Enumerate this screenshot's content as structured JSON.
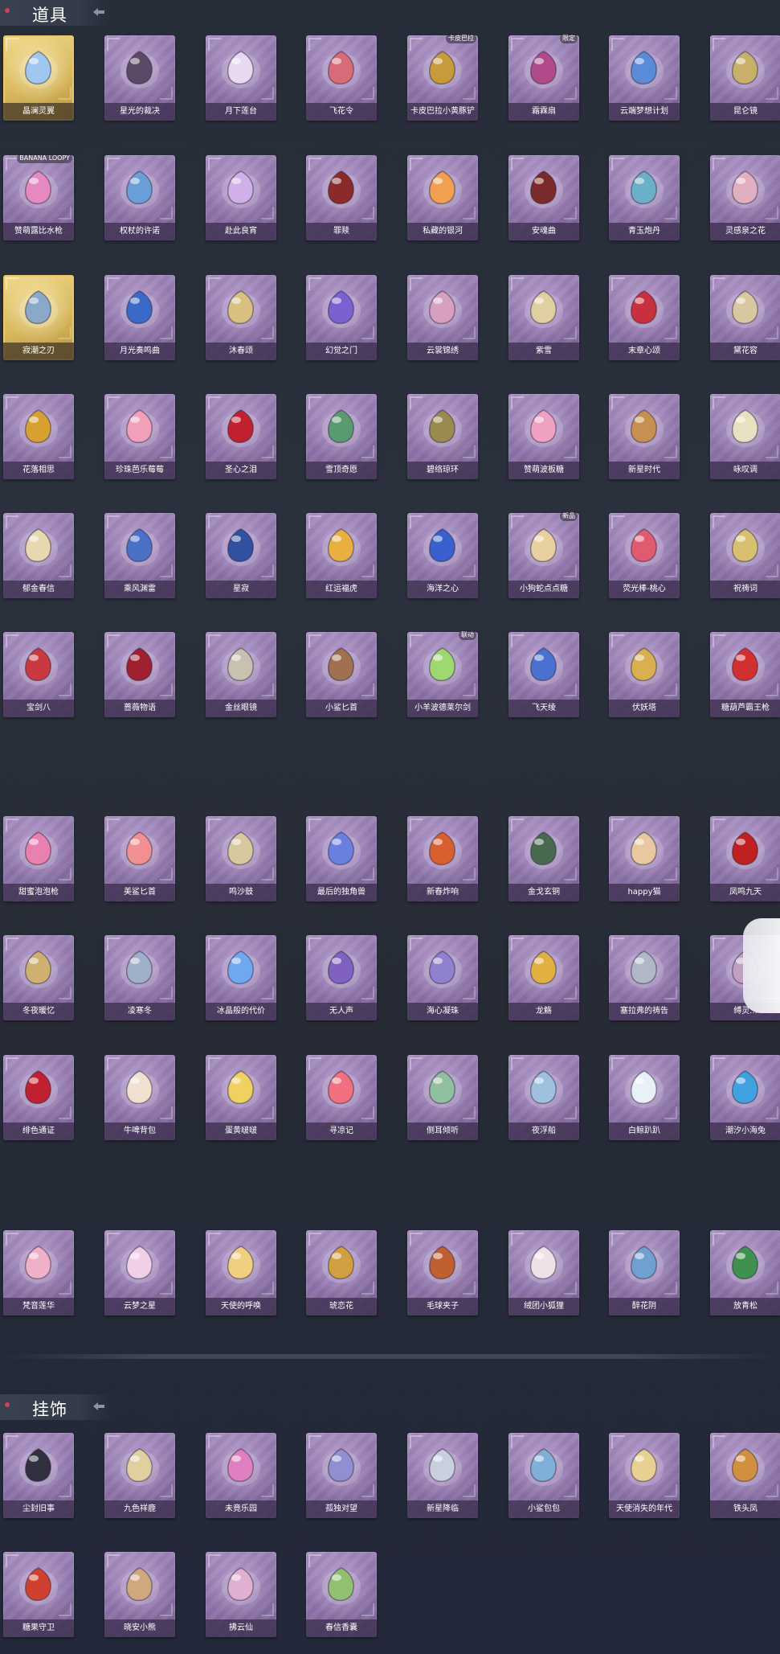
{
  "sections": {
    "props_title": "道具",
    "pendants_title": "挂饰"
  },
  "props_rows": [
    {
      "items": [
        {
          "name": "晶澜灵翼",
          "icon": "crystal-wings",
          "rarity": "gold",
          "color": "#9fc8f0"
        },
        {
          "name": "星光的裁决",
          "icon": "rifle",
          "color": "#5b4a66"
        },
        {
          "name": "月下莲台",
          "icon": "lotus-staff",
          "color": "#e8d8f0"
        },
        {
          "name": "飞花令",
          "icon": "flower-wreath",
          "color": "#d86a7a"
        },
        {
          "name": "卡皮巴拉小黄豚铲",
          "icon": "capybara-shovel",
          "color": "#c79a3a",
          "badge": "卡皮巴拉"
        },
        {
          "name": "霜霖扇",
          "icon": "fan",
          "color": "#b04a8a",
          "badge": "限定"
        },
        {
          "name": "云端梦想计划",
          "icon": "wand",
          "color": "#5a8bd8"
        },
        {
          "name": "昆仑镜",
          "icon": "mirror",
          "color": "#c8b06a"
        }
      ]
    },
    {
      "items": [
        {
          "name": "赞萌露比水枪",
          "icon": "water-gun",
          "color": "#e58ac0",
          "badge": "BANANA LOOPY"
        },
        {
          "name": "权杖的许诺",
          "icon": "scepter",
          "color": "#6a9ed8"
        },
        {
          "name": "赴此良宵",
          "icon": "lantern",
          "color": "#d0b0e8"
        },
        {
          "name": "罪赎",
          "icon": "spear",
          "color": "#8a2a2a"
        },
        {
          "name": "私藏的银河",
          "icon": "cloud-boat",
          "color": "#f0a050"
        },
        {
          "name": "安魂曲",
          "icon": "sword",
          "color": "#7a2a2a"
        },
        {
          "name": "青玉炮丹",
          "icon": "vase",
          "color": "#6ab0c8"
        },
        {
          "name": "灵感泉之花",
          "icon": "bouquet",
          "color": "#e0b0c0"
        }
      ]
    },
    {
      "items": [
        {
          "name": "寂潮之刃",
          "icon": "blade",
          "rarity": "gold",
          "color": "#8aa8c8"
        },
        {
          "name": "月光奏鸣曲",
          "icon": "piano-box",
          "color": "#3a6ac8"
        },
        {
          "name": "沐春颂",
          "icon": "branch",
          "color": "#d8c080"
        },
        {
          "name": "幻觉之门",
          "icon": "tablet",
          "color": "#7a60d0"
        },
        {
          "name": "云裳锦绣",
          "icon": "butterfly",
          "color": "#d8a0c0"
        },
        {
          "name": "紫雪",
          "icon": "pendulum",
          "color": "#e0d0a0"
        },
        {
          "name": "末章心颂",
          "icon": "staff",
          "color": "#c83040"
        },
        {
          "name": "黛花容",
          "icon": "vine",
          "color": "#d8c8a0"
        }
      ]
    },
    {
      "items": [
        {
          "name": "花落相思",
          "icon": "ring-staff",
          "color": "#d8a030"
        },
        {
          "name": "珍珠芭乐莓莓",
          "icon": "drink",
          "color": "#f0a0b8"
        },
        {
          "name": "圣心之泪",
          "icon": "heart-scepter",
          "color": "#c02030"
        },
        {
          "name": "雪顶奇愿",
          "icon": "goblet",
          "color": "#5a9a70"
        },
        {
          "name": "碧络琼环",
          "icon": "hoop",
          "color": "#9a8a50"
        },
        {
          "name": "赞萌波板糖",
          "icon": "lollipop",
          "color": "#f0a0c0"
        },
        {
          "name": "新星时代",
          "icon": "revolver",
          "color": "#c89050"
        },
        {
          "name": "咏叹调",
          "icon": "arch",
          "color": "#e8e0c0"
        }
      ]
    },
    {
      "items": [
        {
          "name": "郁金春信",
          "icon": "umbrella",
          "color": "#e8d8b0"
        },
        {
          "name": "乘风渊雷",
          "icon": "gauntlets",
          "color": "#4a70c8"
        },
        {
          "name": "星寂",
          "icon": "flashlight",
          "color": "#3050a0"
        },
        {
          "name": "红运福虎",
          "icon": "tiger",
          "color": "#e8b040"
        },
        {
          "name": "海洋之心",
          "icon": "necklace",
          "color": "#3a60d0"
        },
        {
          "name": "小狗蛇点点糖",
          "icon": "dog-bowl",
          "color": "#e8d0a0",
          "badge": "新品"
        },
        {
          "name": "荧光棒-桃心",
          "icon": "heart-wand",
          "color": "#e05a70"
        },
        {
          "name": "祝祷词",
          "icon": "cross",
          "color": "#d8c070"
        }
      ]
    },
    {
      "items": [
        {
          "name": "宝剑八",
          "icon": "heart-locket",
          "color": "#c83a40"
        },
        {
          "name": "蔷薇物语",
          "icon": "medkit",
          "color": "#a02030"
        },
        {
          "name": "金丝眼镜",
          "icon": "glasses",
          "color": "#c8c0b0"
        },
        {
          "name": "小鲨匕首",
          "icon": "dagger",
          "color": "#a07050"
        },
        {
          "name": "小羊波德莱尔剑",
          "icon": "green-sword",
          "color": "#a0d870",
          "badge": "联动"
        },
        {
          "name": "飞天绫",
          "icon": "ribbon",
          "color": "#4a70d0"
        },
        {
          "name": "伏妖塔",
          "icon": "pagoda",
          "color": "#d8b050"
        },
        {
          "name": "糖葫芦霸王枪",
          "icon": "candy-spear",
          "color": "#d03030"
        }
      ]
    },
    {
      "items": [
        {
          "name": "甜蜜泡泡枪",
          "icon": "bubble-gun",
          "color": "#e880b0"
        },
        {
          "name": "美鲨匕首",
          "icon": "shark-knife",
          "color": "#f09090"
        },
        {
          "name": "鸣沙鼓",
          "icon": "drum",
          "color": "#d8c8a0"
        },
        {
          "name": "最后的独角兽",
          "icon": "unicorn-horn",
          "color": "#6a80e0"
        },
        {
          "name": "新春炸响",
          "icon": "firecrackers",
          "color": "#d86030"
        },
        {
          "name": "金戈玄铜",
          "icon": "bronze-vessel",
          "color": "#4a6a50"
        },
        {
          "name": "happy猫",
          "icon": "cat-figure",
          "color": "#e8c8a0"
        },
        {
          "name": "凤鸣九天",
          "icon": "phoenix-blade",
          "color": "#c02020"
        }
      ]
    },
    {
      "items": [
        {
          "name": "冬夜暖忆",
          "icon": "snow-globe",
          "color": "#d0b070"
        },
        {
          "name": "凌寒冬",
          "icon": "trident",
          "color": "#a0b0c8"
        },
        {
          "name": "冰晶般的代价",
          "icon": "ice-flower",
          "color": "#70a8f0"
        },
        {
          "name": "无人声",
          "icon": "potion",
          "color": "#8060c0"
        },
        {
          "name": "海心凝珠",
          "icon": "shell",
          "color": "#9080d0"
        },
        {
          "name": "龙觞",
          "icon": "golden-key",
          "color": "#e0b040"
        },
        {
          "name": "塞拉弗的祷告",
          "icon": "halberd",
          "color": "#b0b8c8"
        },
        {
          "name": "缚灵...",
          "icon": "spirit-ring",
          "color": "#c0a0c0"
        }
      ]
    },
    {
      "items": [
        {
          "name": "绯色通证",
          "icon": "rapier",
          "color": "#c02030"
        },
        {
          "name": "牛啤背包",
          "icon": "beer-mug",
          "color": "#f0e0d0"
        },
        {
          "name": "蛋黄啵啵",
          "icon": "chick",
          "color": "#f0d060"
        },
        {
          "name": "寻凉记",
          "icon": "bear-hat",
          "color": "#f07080"
        },
        {
          "name": "侧耳倾听",
          "icon": "flower-ring",
          "color": "#90c0a0"
        },
        {
          "name": "夜浮船",
          "icon": "jellyfish",
          "color": "#a0c0e0"
        },
        {
          "name": "白鲸趴趴",
          "icon": "white-whale",
          "color": "#e8f0f8"
        },
        {
          "name": "潮汐小海兔",
          "icon": "blue-rabbit",
          "color": "#40a0e0"
        }
      ]
    },
    {
      "items": [
        {
          "name": "梵音莲华",
          "icon": "pink-figure",
          "color": "#f0b0c8"
        },
        {
          "name": "云梦之星",
          "icon": "star-fairy",
          "color": "#f0d0e8"
        },
        {
          "name": "天使的呼唤",
          "icon": "angel-figure",
          "color": "#f0d080"
        },
        {
          "name": "琥恋花",
          "icon": "hanging-cage",
          "color": "#d0a040"
        },
        {
          "name": "毛球夹子",
          "icon": "raccoon",
          "color": "#c06030"
        },
        {
          "name": "绒团小狐狸",
          "icon": "fox",
          "color": "#f0e0e8"
        },
        {
          "name": "醉花阴",
          "icon": "chandelier",
          "color": "#70a0d0"
        },
        {
          "name": "放青松",
          "icon": "bonsai",
          "color": "#409050"
        }
      ]
    }
  ],
  "pendant_rows": [
    {
      "items": [
        {
          "name": "尘封旧事",
          "icon": "boy-keychain",
          "color": "#303040"
        },
        {
          "name": "九色祥鹿",
          "icon": "deer-keychain",
          "color": "#e0d0a0"
        },
        {
          "name": "未竟乐园",
          "icon": "girl-keychain",
          "color": "#e080c0"
        },
        {
          "name": "孤独对望",
          "icon": "blue-keychain",
          "color": "#9090d0"
        },
        {
          "name": "新星降临",
          "icon": "star-keychain",
          "color": "#c8d0e0"
        },
        {
          "name": "小鲨包包",
          "icon": "shark-keychain",
          "color": "#80b0d8"
        },
        {
          "name": "天使消失的年代",
          "icon": "veil-keychain",
          "color": "#e8d090"
        },
        {
          "name": "铁头凤",
          "icon": "phoenix-keychain",
          "color": "#d09040"
        }
      ]
    },
    {
      "items": [
        {
          "name": "糖果守卫",
          "icon": "guard-keychain",
          "color": "#d04030"
        },
        {
          "name": "晓安小熊",
          "icon": "bear-keychain",
          "color": "#d0a880"
        },
        {
          "name": "拂云仙",
          "icon": "fairy-keychain",
          "color": "#e0b0d0"
        },
        {
          "name": "春信香囊",
          "icon": "sachet-keychain",
          "color": "#90c070"
        }
      ]
    }
  ]
}
